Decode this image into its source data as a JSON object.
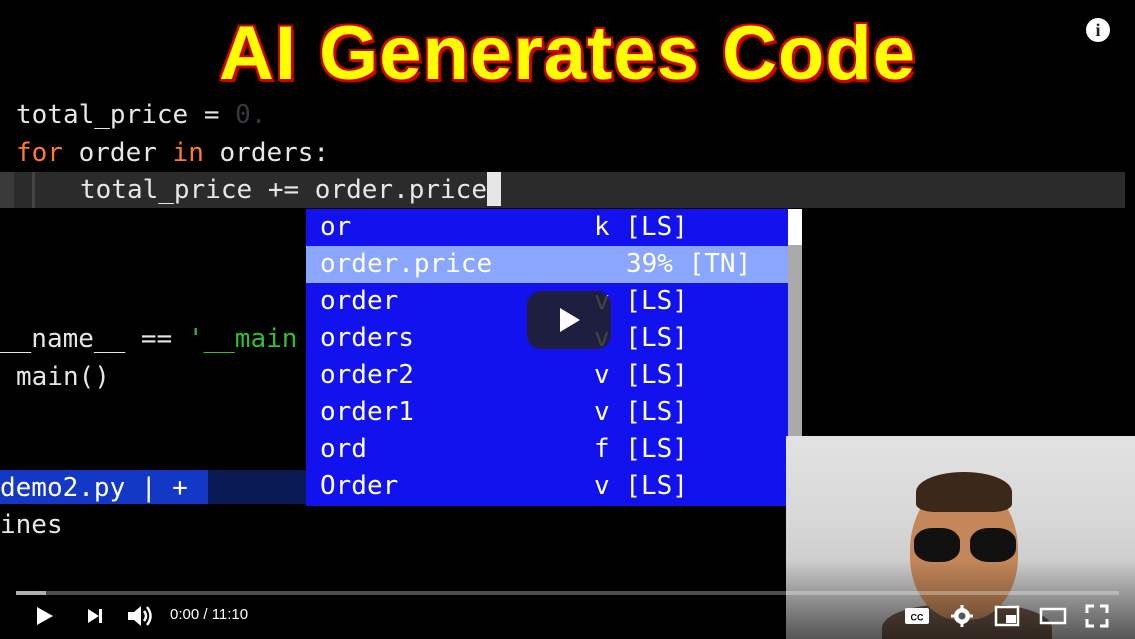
{
  "title": "AI Generates Code",
  "code": {
    "line1_var": "total_price",
    "line1_op": " = ",
    "line1_val": "0.",
    "line2_kw1": "for",
    "line2_a": " order ",
    "line2_kw2": "in",
    "line2_b": " orders:",
    "line3": "total_price += order.price",
    "line4_a": "__name__ == ",
    "line4_str": "'__main",
    "line5": "main()",
    "line6": "ines"
  },
  "statusbar": {
    "label": "demo2.py | +"
  },
  "completion": {
    "items": [
      {
        "word": "or",
        "kind": "k [LS]"
      },
      {
        "word": "order.price",
        "kind": "39% [TN]"
      },
      {
        "word": "order",
        "kind": "v [LS]"
      },
      {
        "word": "orders",
        "kind": "v [LS]"
      },
      {
        "word": "order2",
        "kind": "v [LS]"
      },
      {
        "word": "order1",
        "kind": "v [LS]"
      },
      {
        "word": "ord",
        "kind": "f [LS]"
      },
      {
        "word": "Order",
        "kind": "v [LS]"
      }
    ],
    "selected_index": 1
  },
  "player": {
    "time": "0:00 / 11:10",
    "progress": 0.0,
    "icons": [
      "play-icon",
      "next-icon",
      "volume-icon",
      "captions-icon",
      "settings-icon",
      "miniplayer-icon",
      "theater-icon",
      "fullscreen-icon",
      "info-icon"
    ]
  }
}
